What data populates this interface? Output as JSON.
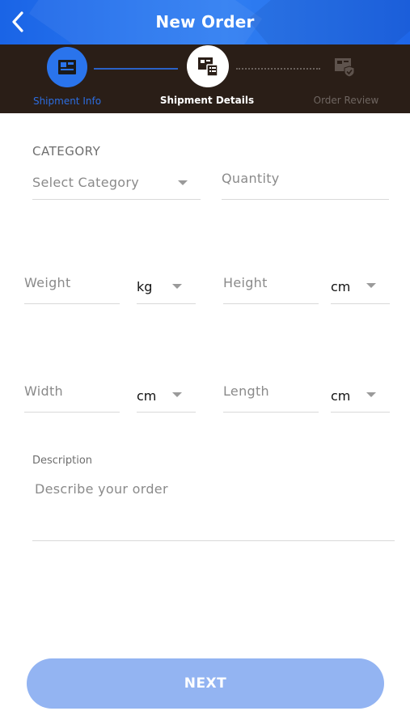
{
  "header": {
    "title": "New Order",
    "back_icon": "chevron-left-icon",
    "color": "#2a78f0"
  },
  "stepper": {
    "steps": [
      {
        "label": "Shipment Info",
        "icon": "package-box-icon",
        "state": "completed"
      },
      {
        "label": "Shipment Details",
        "icon": "package-list-icon",
        "state": "active"
      },
      {
        "label": "Order Review",
        "icon": "package-shield-icon",
        "state": "pending"
      }
    ],
    "background": "#2a1e17",
    "accent": "#2a74ec"
  },
  "form": {
    "category": {
      "label": "CATEGORY",
      "placeholder": "Select Category"
    },
    "quantity": {
      "placeholder": "Quantity"
    },
    "weight": {
      "placeholder": "Weight",
      "unit": "kg"
    },
    "height": {
      "placeholder": "Height",
      "unit": "cm"
    },
    "width": {
      "placeholder": "Width",
      "unit": "cm"
    },
    "length": {
      "placeholder": "Length",
      "unit": "cm"
    },
    "description": {
      "label": "Description",
      "placeholder": "Describe your order"
    }
  },
  "actions": {
    "next_label": "NEXT",
    "next_color": "#93b4f2"
  }
}
